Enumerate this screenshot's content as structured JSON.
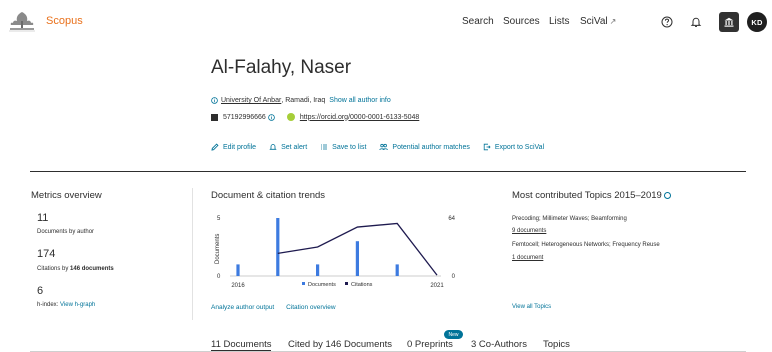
{
  "header": {
    "brand": "Scopus",
    "nav": [
      {
        "label": "Search"
      },
      {
        "label": "Sources"
      },
      {
        "label": "Lists"
      },
      {
        "label": "SciVal",
        "external_icon": "↗"
      }
    ],
    "avatar_initials": "KD",
    "icons": [
      "help-icon",
      "bell-icon",
      "institution-icon"
    ]
  },
  "profile": {
    "name": "Al-Falahy, Naser",
    "affiliation": "University Of Anbar",
    "location": ", Ramadi, Iraq",
    "show_all_info": "Show all author info",
    "author_id": "57192996666",
    "orcid": "https://orcid.org/0000-0001-6133-5048",
    "actions": [
      {
        "label": "Edit profile",
        "icon": "pencil-icon"
      },
      {
        "label": "Set alert",
        "icon": "bell-icon"
      },
      {
        "label": "Save to list",
        "icon": "list-icon"
      },
      {
        "label": "Potential author matches",
        "icon": "people-icon"
      },
      {
        "label": "Export to SciVal",
        "icon": "export-icon"
      }
    ]
  },
  "metrics": {
    "title": "Metrics overview",
    "documents_value": "11",
    "documents_label": "Documents by author",
    "citations_value": "174",
    "citations_label_prefix": "Citations by ",
    "citations_label_bold": "146 documents",
    "hindex_value": "6",
    "hindex_label": "h-index: ",
    "hindex_link": "View h-graph"
  },
  "trends": {
    "title": "Document & citation trends",
    "analyze_link": "Analyze author output",
    "citation_link": "Citation overview"
  },
  "chart_data": {
    "type": "bar",
    "x": [
      2016,
      2017,
      2018,
      2019,
      2020,
      2021
    ],
    "x_tick_labels": [
      "2016",
      "2021"
    ],
    "ylabel_left": "Documents",
    "ylabel_right": "Citations",
    "ylim_left": [
      0,
      5
    ],
    "ylim_right": [
      0,
      64
    ],
    "yticks_left": [
      "5",
      "0"
    ],
    "yticks_right": [
      "64",
      "0"
    ],
    "series": [
      {
        "name": "Documents",
        "type": "bar",
        "axis": "left",
        "values": [
          1,
          5,
          1,
          3,
          1,
          0
        ],
        "color": "#3d7be0"
      },
      {
        "name": "Citations",
        "type": "line",
        "axis": "right",
        "values": [
          null,
          25,
          32,
          54,
          58,
          1
        ],
        "color": "#1e1a4f"
      }
    ],
    "legend_position": "bottom"
  },
  "topics": {
    "title": "Most contributed Topics 2015–2019",
    "items": [
      {
        "name": "Precoding; Millimeter Waves; Beamforming",
        "docs": "9 documents"
      },
      {
        "name": "Femtocell; Heterogeneous Networks; Frequency Reuse",
        "docs": "1 document"
      }
    ],
    "view_all": "View all Topics"
  },
  "tabs": {
    "items": [
      {
        "label": "11 Documents"
      },
      {
        "label": "Cited by 146 Documents"
      },
      {
        "label": "0 Preprints"
      },
      {
        "label": "3 Co-Authors"
      },
      {
        "label": "Topics"
      }
    ],
    "new_badge": "New"
  },
  "colors": {
    "brand": "#e9711c",
    "link": "#007398",
    "documents_bar": "#3d7be0",
    "citations_line": "#1e1a4f"
  }
}
